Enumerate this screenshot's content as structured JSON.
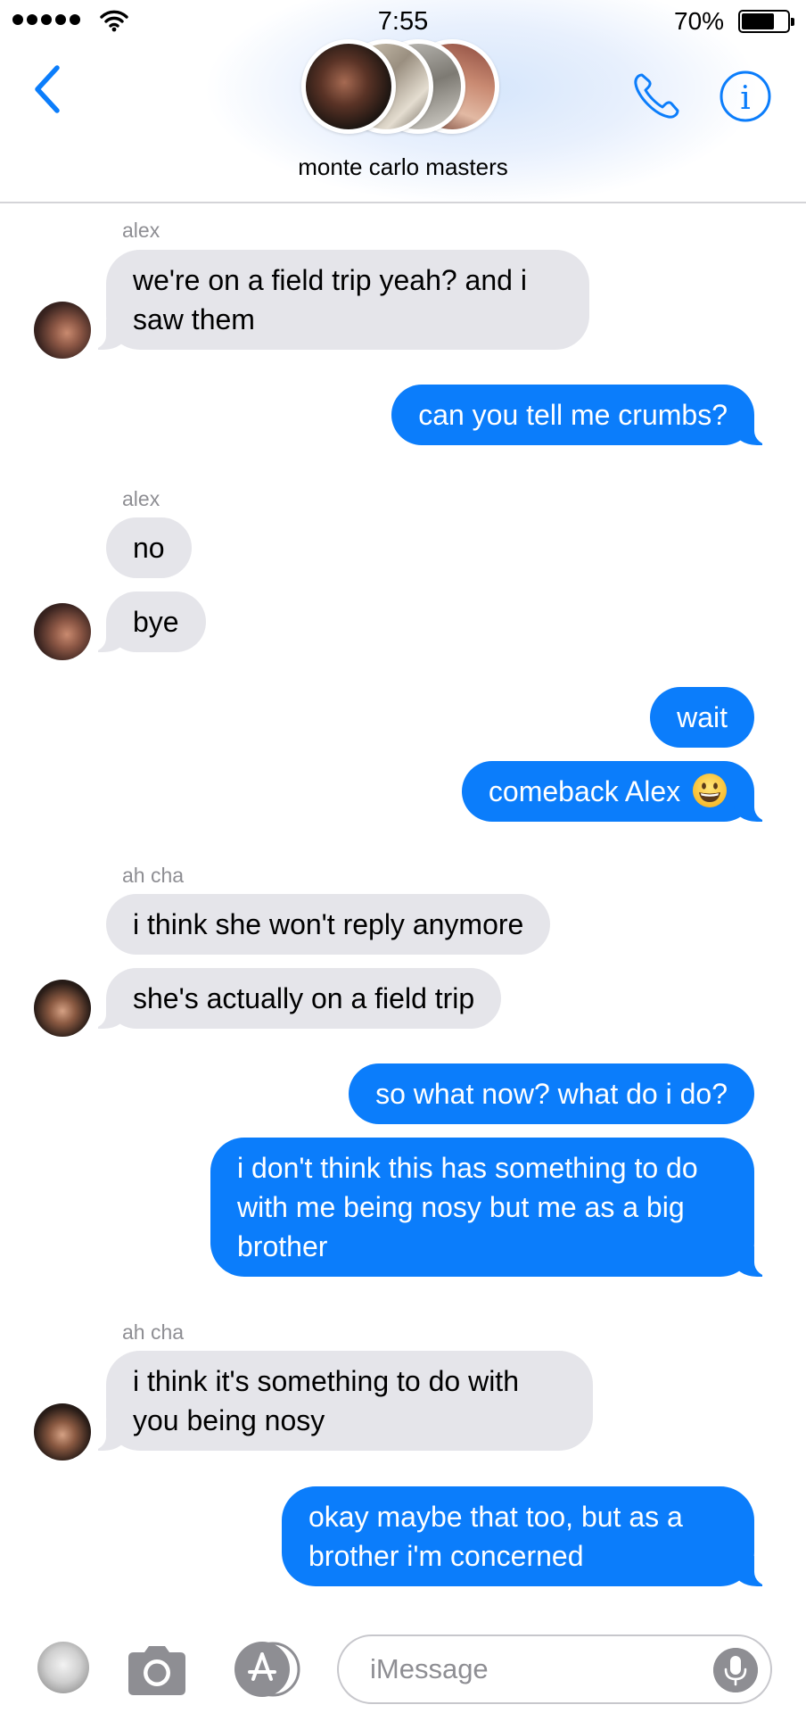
{
  "status_bar": {
    "time": "7:55",
    "battery_percent": "70%",
    "signal_dots": 5,
    "battery_level": 0.7
  },
  "header": {
    "group_name": "monte carlo masters",
    "accent_color": "#0b7dfb",
    "icons": [
      "chevron-left-icon",
      "phone-icon",
      "info-icon"
    ]
  },
  "messages": [
    {
      "sender": "alex",
      "direction": "incoming",
      "text": "we're on a field trip yeah? and i saw them"
    },
    {
      "direction": "outgoing",
      "text": "can you tell me crumbs?"
    },
    {
      "sender": "alex",
      "direction": "incoming",
      "text": "no"
    },
    {
      "direction": "incoming",
      "text": "bye"
    },
    {
      "direction": "outgoing",
      "text": "wait"
    },
    {
      "direction": "outgoing",
      "text": "comeback Alex",
      "emoji": "grinning-face"
    },
    {
      "sender": "ah cha",
      "direction": "incoming",
      "text": "i think she won't reply anymore"
    },
    {
      "direction": "incoming",
      "text": "she's actually on a field trip"
    },
    {
      "direction": "outgoing",
      "text": "so what now? what do i do?"
    },
    {
      "direction": "outgoing",
      "text": "i don't think this has something to do with me being nosy but me as a big brother"
    },
    {
      "sender": "ah cha",
      "direction": "incoming",
      "text": "i think it's something to do with you being nosy"
    },
    {
      "direction": "outgoing",
      "text": "okay maybe that too, but as a brother i'm concerned"
    }
  ],
  "composer": {
    "placeholder": "iMessage",
    "icons": [
      "photos-icon",
      "camera-icon",
      "app-store-icon",
      "microphone-icon"
    ]
  },
  "colors": {
    "incoming_bubble": "#e5e5ea",
    "outgoing_bubble": "#0b7dfb"
  }
}
